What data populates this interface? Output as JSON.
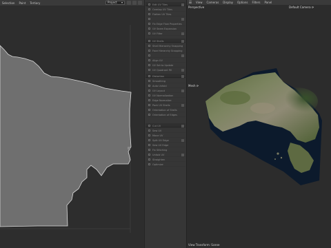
{
  "uv_editor": {
    "menu": [
      "Selection",
      "Paint",
      "Tertiary"
    ],
    "project_dropdown": "Project"
  },
  "properties": {
    "group1": [
      "Edit UV Tiles",
      "Overlap UV Tiles",
      "Flatten UV Tiles",
      "",
      "Fix Edge Flow Properties",
      "UV Seam Expansion",
      "UV Filter"
    ],
    "group2": [
      "UV Shells",
      "Shell Hierarchy Snapping",
      "Face Hierarchy Snapping",
      "",
      "Align UV",
      "UV Set to Update",
      "UV Quadrant Fill"
    ],
    "group3": [
      "Distortion",
      "Smoothing",
      "Auto Unfold",
      "UV Layout",
      "UV Normalization",
      "Edge Normalize",
      "Pack UV Shells",
      "Orientation of Shells",
      "Orientation of Edges"
    ],
    "group4": [
      "Cut UV",
      "Sew UV",
      "Move UV",
      "Split UV Edge",
      "Sew UV Edge",
      "Fix Stitching",
      "Unfold UV",
      "Straighten",
      "Optimize"
    ]
  },
  "viewport": {
    "menu": [
      "View",
      "Cameras",
      "Display",
      "Options",
      "Filters",
      "Panel"
    ],
    "perspective_label": "Perspective",
    "camera_label": "Default Camera ⟳",
    "mesh_label": "Mesh ⟳",
    "transform_label": "View Transform: Scene"
  },
  "colors": {
    "uv_shape_fill": "#6f6f6f",
    "uv_shape_edge": "#dcdcdc",
    "terrain_water": "#0c1a2c"
  }
}
